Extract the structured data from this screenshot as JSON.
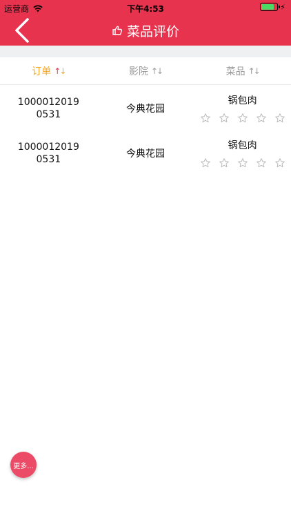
{
  "status_bar": {
    "carrier": "运营商",
    "time": "下午4:53",
    "battery_level": 0.8
  },
  "nav": {
    "title": "菜品评价",
    "back_icon": "chevron-left-icon",
    "title_icon": "thumbs-up-icon"
  },
  "tabs": [
    {
      "label": "订单",
      "active": true
    },
    {
      "label": "影院",
      "active": false
    },
    {
      "label": "菜品",
      "active": false
    }
  ],
  "rows": [
    {
      "order_id": "10000120190531",
      "cinema": "今典花园",
      "dish": "锅包肉",
      "rating": 0,
      "max_rating": 5
    },
    {
      "order_id": "10000120190531",
      "cinema": "今典花园",
      "dish": "锅包肉",
      "rating": 0,
      "max_rating": 5
    }
  ],
  "more_button": {
    "label": "更多..."
  },
  "colors": {
    "brand": "#e8334f",
    "active_tab": "#f5a623",
    "inactive_tab": "#9a9a9a",
    "star_outline": "#b5b5b5"
  }
}
